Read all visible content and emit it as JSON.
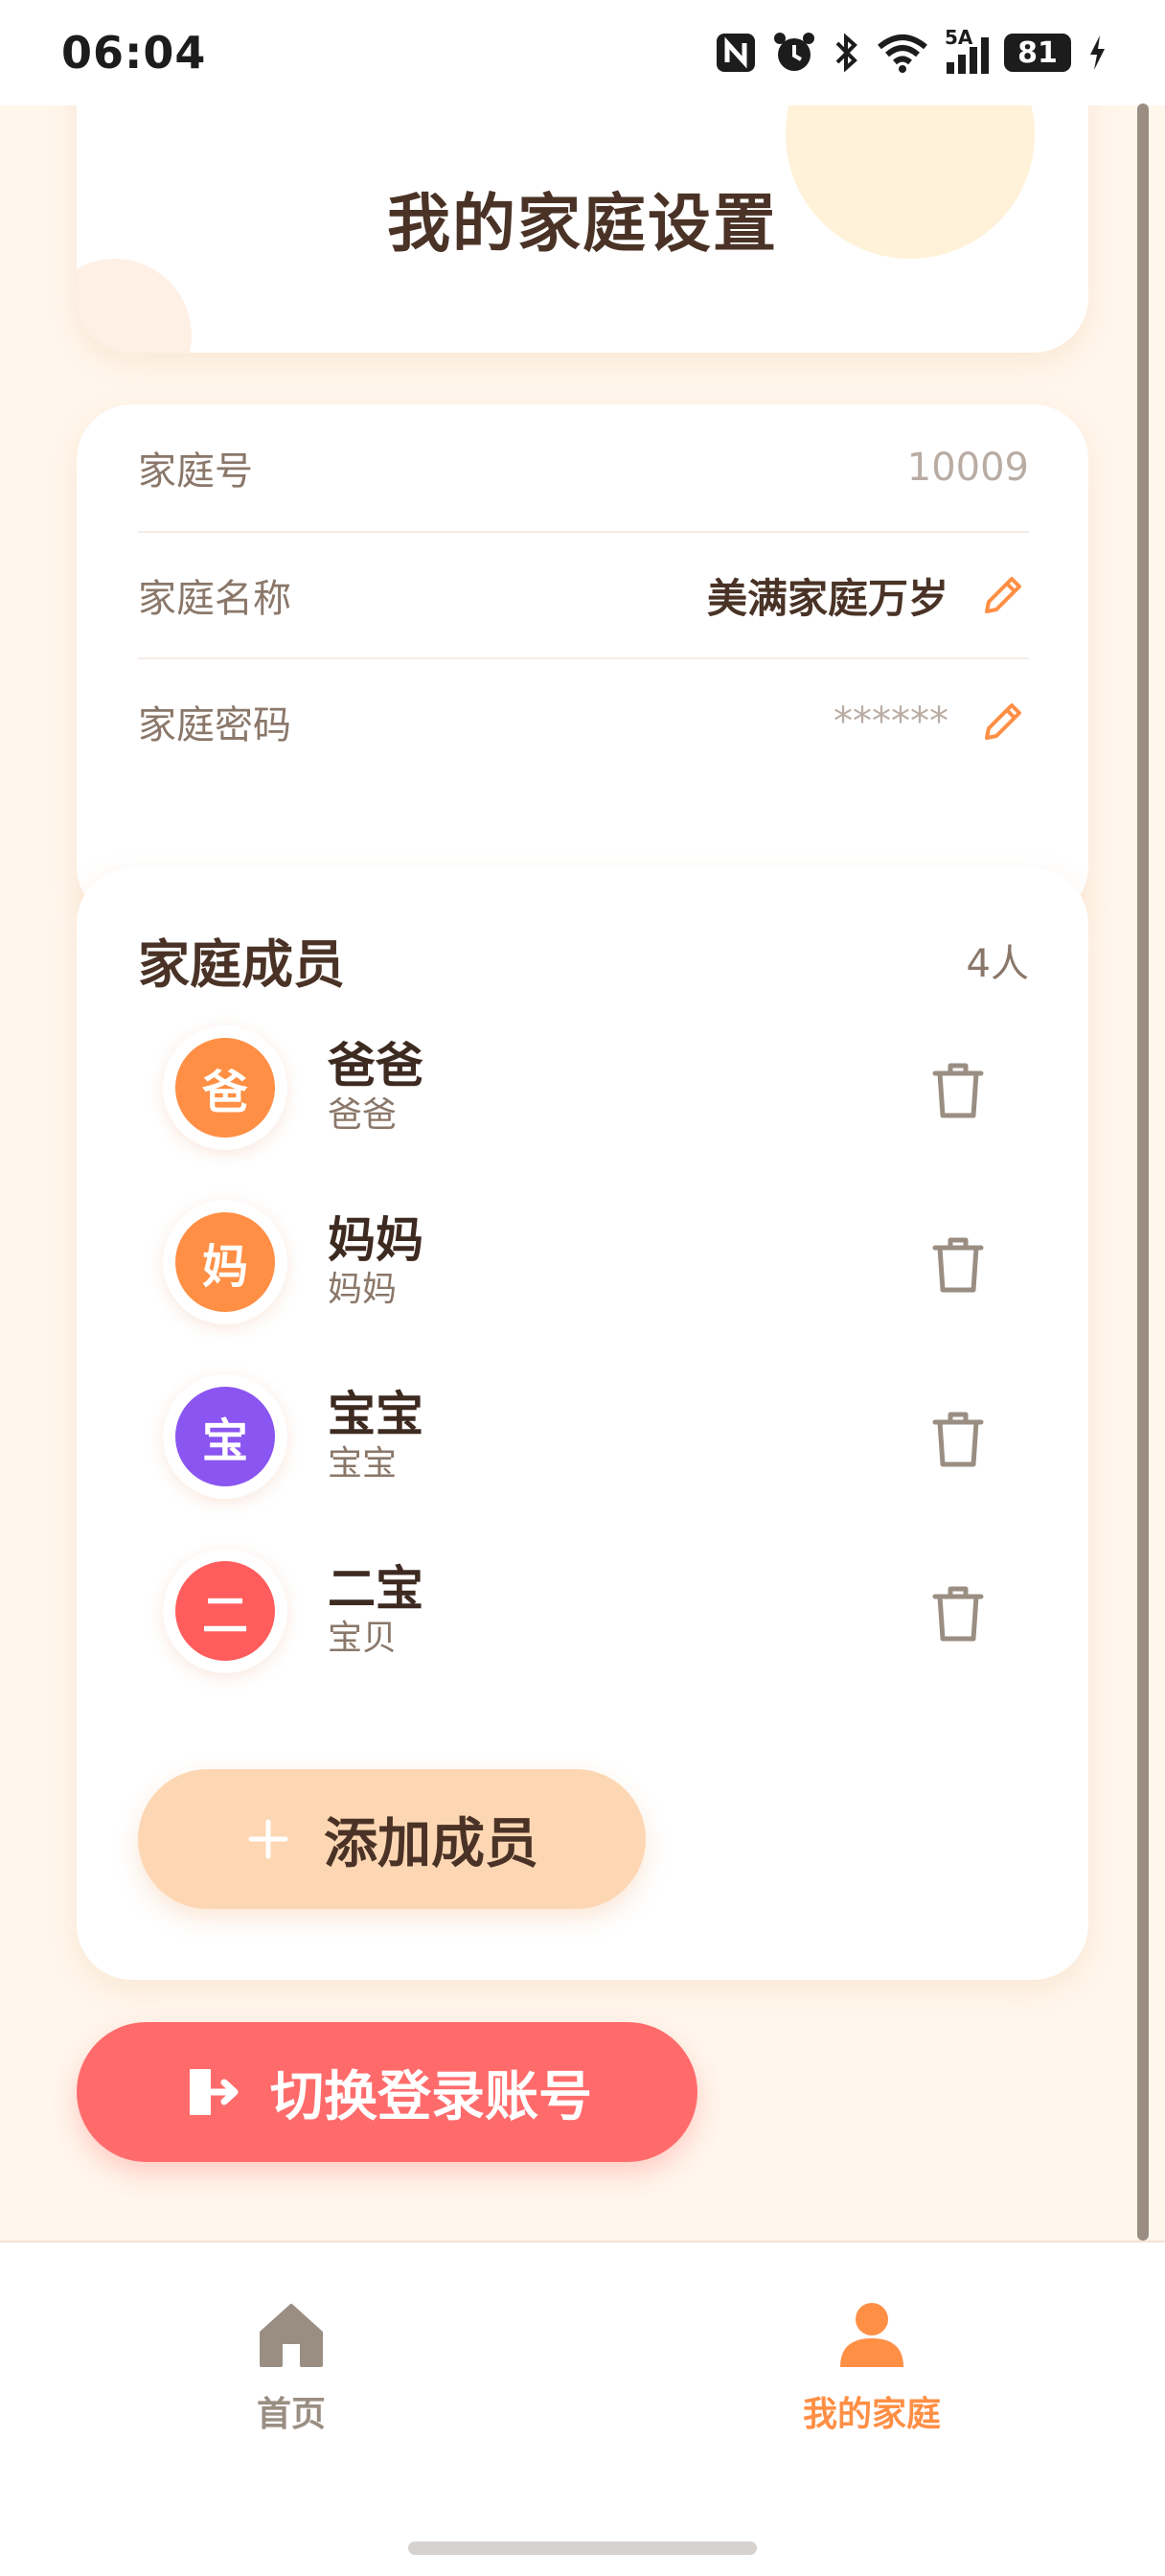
{
  "status_bar": {
    "time": "06:04",
    "network": "5A",
    "battery": "81",
    "icons": [
      "nfc-icon",
      "alarm-icon",
      "bluetooth-icon",
      "wifi-icon",
      "signal-icon",
      "battery-icon",
      "charging-icon"
    ]
  },
  "header": {
    "title": "我的家庭设置"
  },
  "family_info": {
    "id_label": "家庭号",
    "id_value": "10009",
    "name_label": "家庭名称",
    "name_value": "美满家庭万岁",
    "password_label": "家庭密码",
    "password_value": "******"
  },
  "members": {
    "title": "家庭成员",
    "count": "4人",
    "list": [
      {
        "avatar": "爸",
        "name": "爸爸",
        "role": "爸爸",
        "color": "#ff8f45"
      },
      {
        "avatar": "妈",
        "name": "妈妈",
        "role": "妈妈",
        "color": "#ff8f45"
      },
      {
        "avatar": "宝",
        "name": "宝宝",
        "role": "宝宝",
        "color": "#8a55f0"
      },
      {
        "avatar": "二",
        "name": "二宝",
        "role": "宝贝",
        "color": "#ff5d5d"
      }
    ],
    "add_label": "添加成员"
  },
  "logout": {
    "label": "切换登录账号"
  },
  "nav": {
    "home_label": "首页",
    "family_label": "我的家庭",
    "active": "我的家庭"
  },
  "colors": {
    "accent": "#ff8f45",
    "danger": "#ff6b6b",
    "background": "#fff6ec",
    "text": "#4a3326",
    "muted": "#8a7769"
  }
}
